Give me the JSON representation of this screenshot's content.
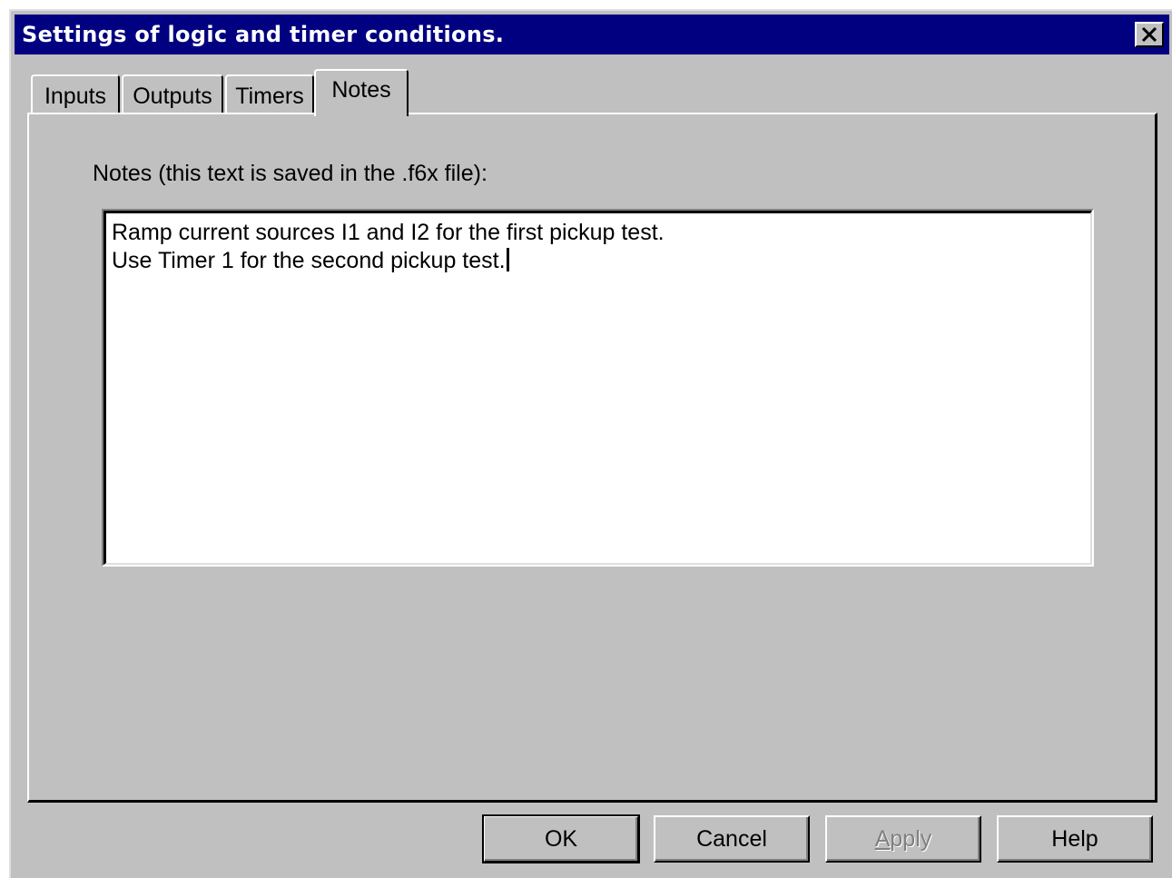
{
  "window": {
    "title": "Settings of logic and timer conditions."
  },
  "tabs": [
    {
      "label": "Inputs",
      "active": false
    },
    {
      "label": "Outputs",
      "active": false
    },
    {
      "label": "Timers",
      "active": false
    },
    {
      "label": "Notes",
      "active": true
    }
  ],
  "notes": {
    "label": "Notes (this text is saved in the .f6x file):",
    "lines": [
      "Ramp current sources I1 and I2 for the first pickup test.",
      "Use Timer 1 for the second pickup test."
    ]
  },
  "buttons": {
    "ok": "OK",
    "cancel": "Cancel",
    "apply_mnemonic": "A",
    "apply_rest": "pply",
    "help": "Help"
  },
  "colors": {
    "titlebar": "#000080",
    "face": "#c0c0c0"
  },
  "icons": {
    "close": "close-icon"
  }
}
